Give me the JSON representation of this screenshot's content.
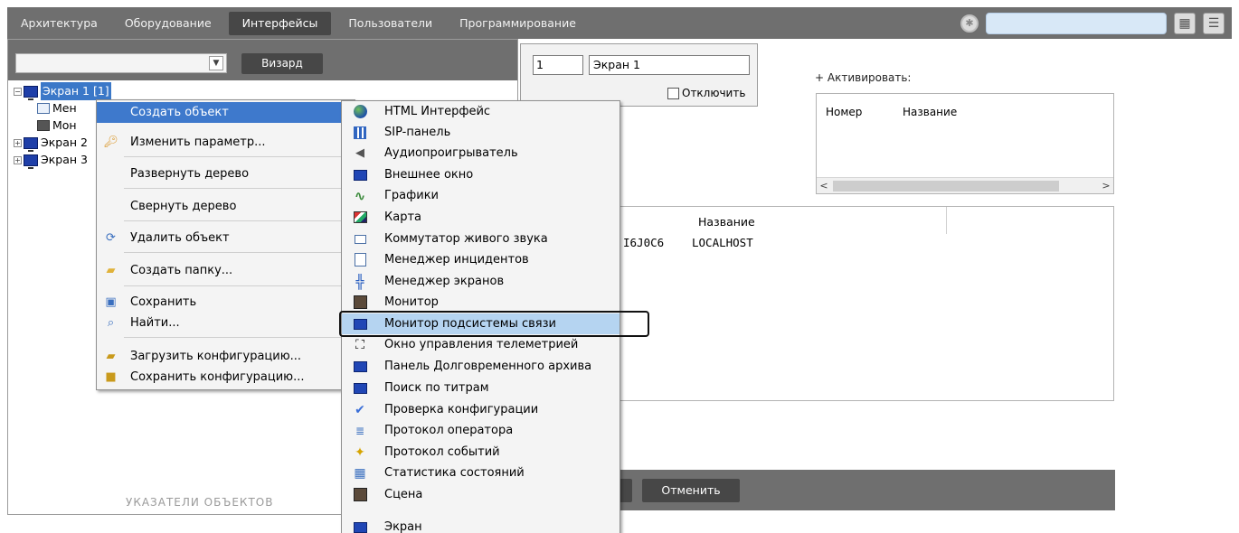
{
  "nav": {
    "tabs": [
      "Архитектура",
      "Оборудование",
      "Интерфейсы",
      "Пользователи",
      "Программирование"
    ],
    "active_index": 2
  },
  "left_panel": {
    "wizard_label": "Визард",
    "tree": {
      "screen1_label": "Экран 1 [1]",
      "child1_label": "Мен",
      "child2_label": "Мон",
      "screen2_label": "Экран 2",
      "screen3_label": "Экран 3"
    },
    "cut_label": "УКАЗАТЕЛИ ОБЪЕКТОВ"
  },
  "settings": {
    "number_value": "1",
    "name_value": "Экран 1",
    "disable_label": "Отключить",
    "activate_label": "+ Активировать:",
    "act_table_headers": [
      "Номер",
      "Название"
    ]
  },
  "host_table": {
    "header": "Название",
    "id_cell": "I6J0C6",
    "name_cell": "LOCALHOST"
  },
  "buttons": {
    "cancel_label": "Отменить"
  },
  "context_menu": {
    "items": [
      {
        "label": "Создать объект",
        "icon": "none"
      },
      {
        "label": "Изменить параметр...",
        "icon": "key-icon"
      },
      {
        "label": "Развернуть дерево",
        "icon": "none"
      },
      {
        "label": "Свернуть дерево",
        "icon": "none"
      },
      {
        "label": "Удалить объект",
        "icon": "delete-icon"
      },
      {
        "label": "Создать папку...",
        "icon": "folder-star-icon"
      },
      {
        "label": "Сохранить",
        "icon": "save-icon"
      },
      {
        "label": "Найти...",
        "icon": "magnifier-icon"
      },
      {
        "label": "Загрузить конфигурацию...",
        "icon": "folder-open-icon"
      },
      {
        "label": "Сохранить конфигурацию...",
        "icon": "box-icon"
      }
    ]
  },
  "submenu": {
    "items": [
      "HTML Интерфейс",
      "SIP-панель",
      "Аудиопроигрыватель",
      "Внешнее окно",
      "Графики",
      "Карта",
      "Коммутатор живого звука",
      "Менеджер инцидентов",
      "Менеджер экранов",
      "Монитор",
      "Монитор подсистемы связи",
      "Окно управления телеметрией",
      "Панель Долговременного архива",
      "Поиск по титрам",
      "Проверка конфигурации",
      "Протокол оператора",
      "Протокол событий",
      "Статистика состояний",
      "Сцена",
      "Экран"
    ],
    "selected_index": 10
  },
  "colors": {
    "toolbar_gray": "#6f6f6f",
    "active_tab": "#474747",
    "menu_hover": "#3e79cc",
    "submenu_selected": "#b5d4f1"
  }
}
